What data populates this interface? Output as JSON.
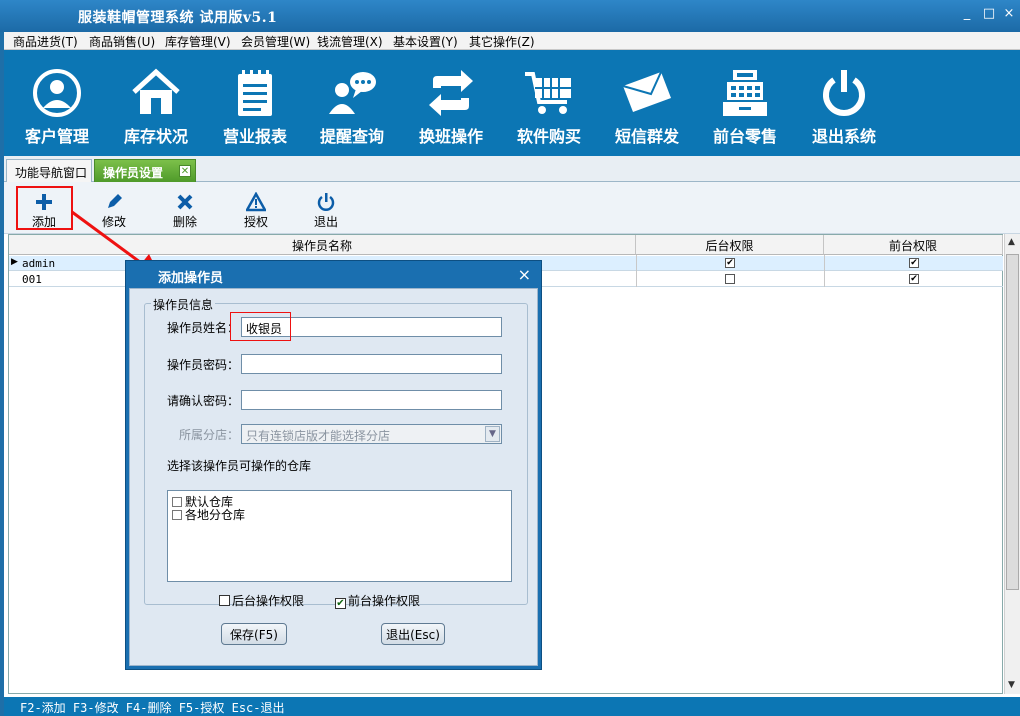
{
  "window": {
    "title": "服装鞋帽管理系统 试用版v5.1",
    "controls": [
      "_",
      "□",
      "×"
    ]
  },
  "menubar": [
    "商品进货(T)",
    "商品销售(U)",
    "库存管理(V)",
    "会员管理(W)",
    "钱流管理(X)",
    "基本设置(Y)",
    "其它操作(Z)"
  ],
  "toolbar": [
    {
      "label": "客户管理",
      "icon": "user-avatar-icon"
    },
    {
      "label": "库存状况",
      "icon": "house-icon"
    },
    {
      "label": "营业报表",
      "icon": "notepad-icon"
    },
    {
      "label": "提醒查询",
      "icon": "chat-bubble-icon"
    },
    {
      "label": "换班操作",
      "icon": "swap-arrows-icon"
    },
    {
      "label": "软件购买",
      "icon": "shopping-cart-icon"
    },
    {
      "label": "短信群发",
      "icon": "envelope-icon"
    },
    {
      "label": "前台零售",
      "icon": "cash-register-icon"
    },
    {
      "label": "退出系统",
      "icon": "power-icon"
    }
  ],
  "tabs": [
    {
      "label": "功能导航窗口",
      "active": false
    },
    {
      "label": "操作员设置",
      "active": true
    }
  ],
  "subtoolbar": [
    {
      "label": "添加",
      "icon": "plus-icon"
    },
    {
      "label": "修改",
      "icon": "pencil-icon"
    },
    {
      "label": "删除",
      "icon": "x-icon"
    },
    {
      "label": "授权",
      "icon": "warning-icon"
    },
    {
      "label": "退出",
      "icon": "power-icon"
    }
  ],
  "grid": {
    "columns": [
      "操作员名称",
      "后台权限",
      "前台权限"
    ],
    "rows": [
      {
        "name": "admin",
        "backend": true,
        "frontend": true,
        "selected": true
      },
      {
        "name": "001",
        "backend": false,
        "frontend": true,
        "selected": false
      }
    ]
  },
  "dialog": {
    "title": "添加操作员",
    "close": "×",
    "group_label": "操作员信息",
    "name_label": "操作员姓名：",
    "name_value": "收银员",
    "password_label": "操作员密码：",
    "password_value": "",
    "confirm_label": "请确认密码：",
    "confirm_value": "",
    "branch_label": "所属分店：",
    "branch_value": "只有连锁店版才能选择分店",
    "warehouse_label": "选择该操作员可操作的仓库",
    "warehouses": [
      {
        "label": "默认仓库",
        "checked": false
      },
      {
        "label": "各地分仓库",
        "checked": false
      }
    ],
    "backend_perm": {
      "label": "后台操作权限",
      "checked": false
    },
    "frontend_perm": {
      "label": "前台操作权限",
      "checked": true
    },
    "save_button": "保存(F5)",
    "exit_button": "退出(Esc)"
  },
  "statusbar": "F2-添加 F3-修改 F4-删除 F5-授权 Esc-退出",
  "colors": {
    "brand_blue": "#0c76b4",
    "highlight_red": "#e11111"
  }
}
